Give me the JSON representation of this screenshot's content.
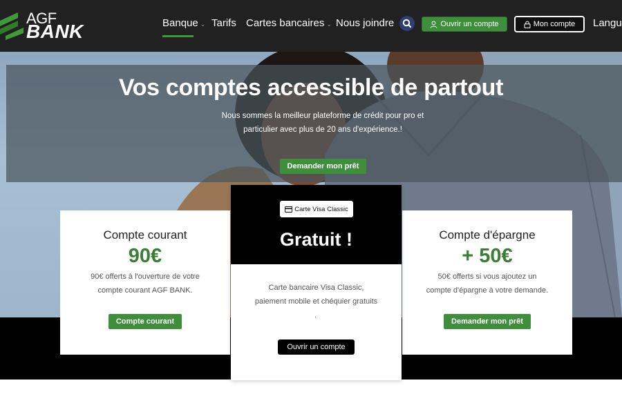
{
  "brand": {
    "logo_top": "AGF",
    "logo_bottom": "BANK",
    "accent_color": "#3f8e3c",
    "header_bg": "#212121"
  },
  "nav": {
    "items": [
      {
        "label": "Banque",
        "has_dropdown": true,
        "active": true
      },
      {
        "label": "Tarifs",
        "has_dropdown": false,
        "active": false
      },
      {
        "label": "Cartes bancaires",
        "has_dropdown": true,
        "active": false
      },
      {
        "label": "Nous joindre",
        "has_dropdown": false,
        "active": false
      }
    ],
    "search_icon": "search-icon",
    "open_account_label": "Ouvrir un compte",
    "open_account_icon": "user-icon",
    "my_account_label": "Mon compte",
    "my_account_icon": "lock-icon",
    "language_label": "Langue"
  },
  "hero": {
    "title": "Vos comptes accessible de partout",
    "subtitle_line1": "Nous sommes la meilleur plateforme de crédit pour pro et",
    "subtitle_line2": "particulier avec plus de 20 ans d'expérience.!",
    "cta_label": "Demander mon prêt"
  },
  "offers": {
    "current_account": {
      "title": "Compte courant",
      "amount": "90€",
      "text_line1": "90€ offerts à l'ouverture de votre",
      "text_line2": "compte courant AGF BANK.",
      "button_label": "Compte courant"
    },
    "visa_card": {
      "badge_label": "Carte Visa Classic",
      "badge_icon": "credit-card-icon",
      "title": "Gratuit !",
      "text_line1": "Carte bancaire Visa Classic,",
      "text_line2": "paiement mobile et chéquier gratuits",
      "text_line3": ".",
      "button_label": "Ouvrir un compte"
    },
    "savings_account": {
      "title": "Compte d'épargne",
      "amount": "+ 50€",
      "text_line1": "50€ offerts si vous ajoutez un",
      "text_line2": "compte d'épargne à votre demande.",
      "button_label": "Demander mon prêt"
    }
  }
}
